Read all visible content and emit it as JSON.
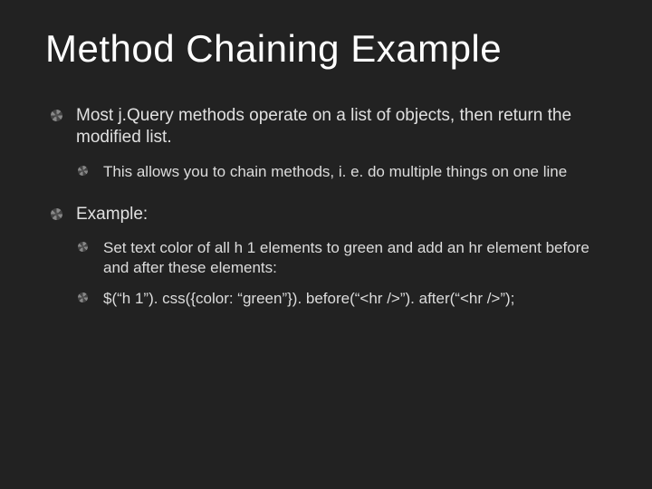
{
  "title": "Method Chaining Example",
  "bullets": [
    {
      "text": "Most j.Query methods operate on a list of objects, then return the modified list.",
      "children": [
        {
          "text": "This allows you to chain methods, i. e. do multiple things on one line"
        }
      ]
    },
    {
      "text": "Example:",
      "children": [
        {
          "text": "Set text color of all h 1 elements to green and add an hr element before and after these elements:"
        },
        {
          "text": "$(“h 1”). css({color: “green”}). before(“<hr />”). after(“<hr />”);"
        }
      ]
    }
  ]
}
